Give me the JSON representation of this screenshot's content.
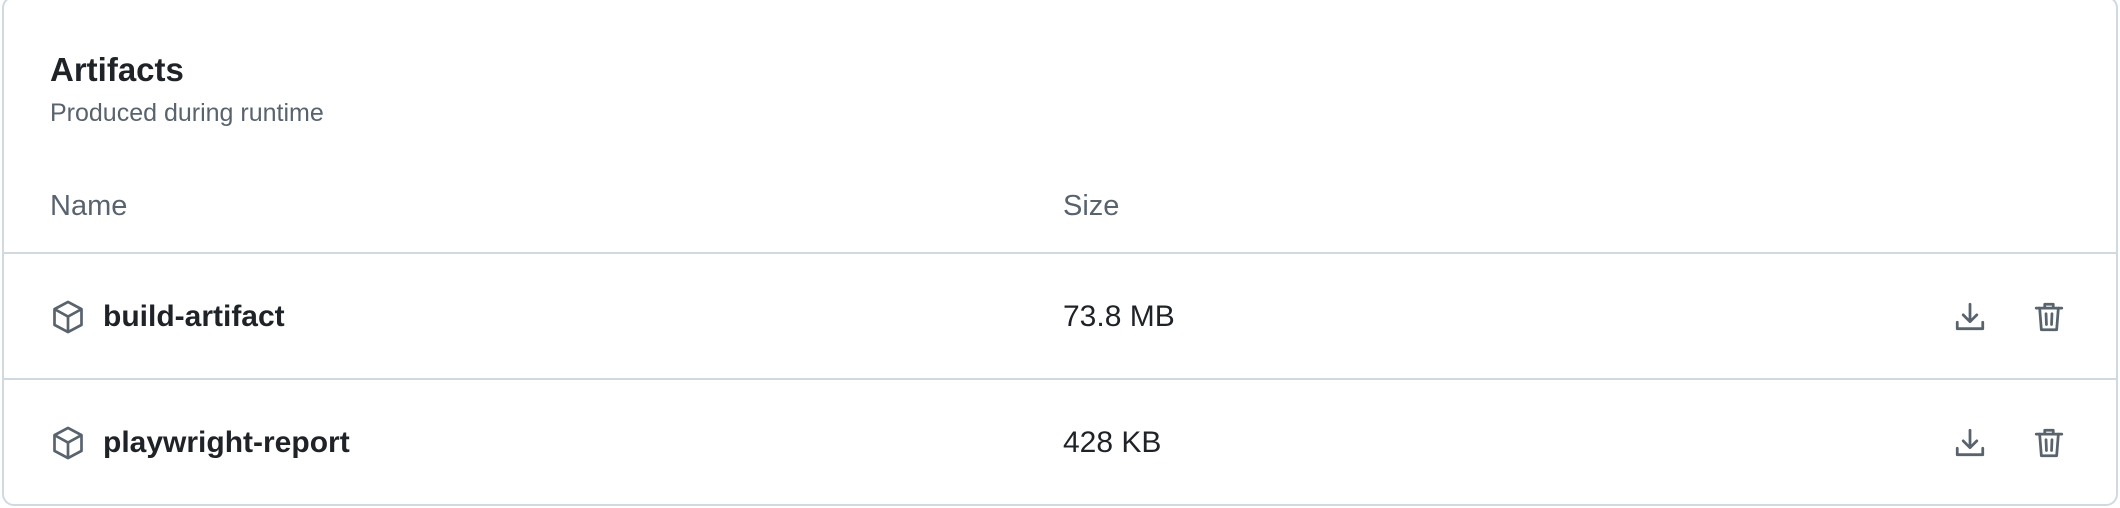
{
  "artifacts": {
    "title": "Artifacts",
    "subtitle": "Produced during runtime",
    "columns": {
      "name": "Name",
      "size": "Size"
    },
    "rows": [
      {
        "name": "build-artifact",
        "size": "73.8 MB",
        "icon": "package-icon",
        "actions": [
          "download-icon",
          "trash-icon"
        ]
      },
      {
        "name": "playwright-report",
        "size": "428 KB",
        "icon": "package-icon",
        "actions": [
          "download-icon",
          "trash-icon"
        ]
      }
    ]
  },
  "colors": {
    "text_primary": "#1f2328",
    "text_muted": "#59636e",
    "border": "#d1d9e0"
  }
}
